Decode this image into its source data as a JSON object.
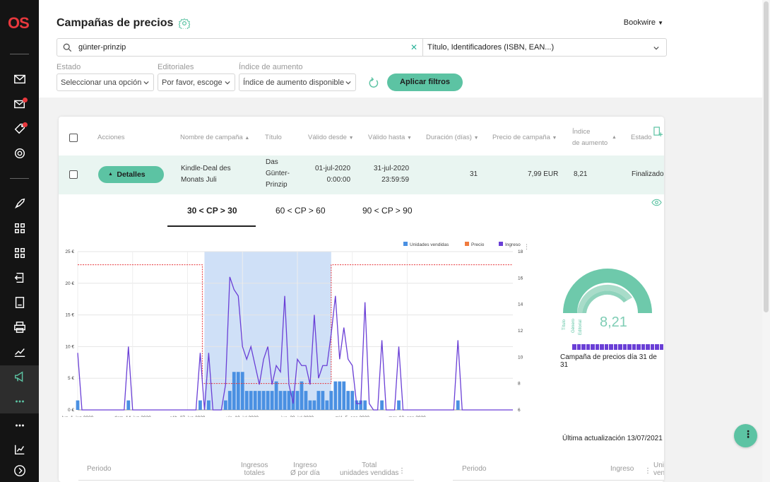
{
  "app": {
    "logo": "OS"
  },
  "header": {
    "title": "Campañas de precios",
    "account": "Bookwire",
    "search": {
      "value": "günter-prinzip",
      "field": "Título, Identificadores (ISBN, EAN...)"
    },
    "filters": {
      "estado": {
        "label": "Estado",
        "value": "Seleccionar una opción"
      },
      "editoriales": {
        "label": "Editoriales",
        "value": "Por favor, escoge"
      },
      "indice": {
        "label": "Índice de aumento",
        "value": "Índice de aumento disponible"
      },
      "apply_label": "Aplicar filtros"
    }
  },
  "table": {
    "headers": {
      "acciones": "Acciones",
      "nombre": "Nombre de campaña",
      "titulo": "Título",
      "desde": "Válido desde",
      "hasta": "Válido hasta",
      "duracion": "Duración (días)",
      "precio": "Precio de campaña",
      "indice_l1": "Índice",
      "indice_l2": "de aumento",
      "estado": "Estado"
    },
    "row": {
      "details_label": "Detalles",
      "nombre_l1": "Kindle-Deal des",
      "nombre_l2": "Monats Juli",
      "titulo_l1": "Das",
      "titulo_l2": "Günter-",
      "titulo_l3": "Prinzip",
      "desde_l1": "01-jul-2020",
      "desde_l2": "0:00:00",
      "hasta_l1": "31-jul-2020",
      "hasta_l2": "23:59:59",
      "duracion": "31",
      "precio": "7,99 EUR",
      "indice": "8,21",
      "estado": "Finalizado"
    }
  },
  "tabs": [
    "30 < CP > 30",
    "60 < CP > 60",
    "90 < CP > 90"
  ],
  "chart_data": {
    "type": "bar",
    "legend": [
      "Unidades vendidas",
      "Precio",
      "Ingreso"
    ],
    "y_left_ticks": [
      "0 €",
      "5 €",
      "10 €",
      "15 €",
      "20 €",
      "25 €"
    ],
    "y_right_ticks": [
      "6",
      "8",
      "10",
      "12",
      "14",
      "16",
      "18"
    ],
    "y_right_label": "Precio",
    "x_ticks": [
      "lun, 1. jun 2020",
      "dom, 14. jun 2020",
      "sáb, 27. jun 2020",
      "vie, 10. jul 2020",
      "jue, 23. jul 2020",
      "mié, 5. ago 2020",
      "mar, 18. ago 2020"
    ],
    "ylim_left": [
      0,
      25
    ],
    "ylim_right": [
      6,
      18
    ],
    "campaign_window_days": [
      30,
      60
    ],
    "units": [
      1,
      0,
      0,
      0,
      0,
      0,
      0,
      0,
      0,
      0,
      0,
      0,
      1,
      0,
      0,
      0,
      0,
      0,
      0,
      0,
      0,
      0,
      0,
      0,
      0,
      0,
      0,
      0,
      0,
      1,
      0,
      1,
      0,
      0,
      0,
      1,
      2,
      4,
      4,
      4,
      2,
      2,
      2,
      2,
      2,
      2,
      2,
      3,
      2,
      2,
      2,
      2,
      2,
      3,
      2,
      1,
      1,
      2,
      2,
      1,
      2,
      3,
      3,
      3,
      2,
      2,
      1,
      1,
      1,
      0,
      0,
      0,
      1,
      0,
      0,
      0,
      1,
      0,
      0,
      0,
      0,
      0,
      0,
      0,
      0,
      0,
      0,
      0,
      0,
      0,
      1,
      0,
      0,
      0,
      0,
      0,
      0,
      0,
      0,
      0,
      0,
      0,
      0,
      0
    ],
    "ingreso": [
      9,
      0,
      0,
      0,
      0,
      0,
      0,
      0,
      0,
      0,
      0,
      0,
      10,
      0,
      0,
      0,
      0,
      0,
      0,
      0,
      0,
      0,
      0,
      0,
      0,
      0,
      0,
      0,
      0,
      9,
      0,
      9,
      0,
      0,
      0,
      4,
      21,
      19,
      18,
      10,
      8,
      10,
      7,
      4,
      8,
      10,
      4,
      7,
      6,
      18,
      4,
      1,
      8,
      7,
      7,
      4,
      15,
      5,
      7,
      7,
      12,
      18,
      8,
      13,
      8,
      7,
      1,
      1,
      17,
      1,
      0,
      0,
      11,
      0,
      0,
      0,
      10,
      0,
      0,
      0,
      0,
      0,
      0,
      0,
      0,
      0,
      0,
      0,
      0,
      0,
      11,
      0,
      0,
      0,
      0,
      0,
      0,
      0,
      0,
      0,
      0,
      0,
      0,
      0
    ],
    "precio": {
      "base": 17,
      "campaign": 8
    }
  },
  "gauge": {
    "value": "8,21",
    "labels": [
      "Título",
      "Género",
      "Editorial"
    ],
    "progress_text": "Campaña de precios día 31 de 31",
    "progress": 1.0
  },
  "update_text": "Última actualización 13/07/2021",
  "bottom_headers": {
    "periodo1": "Periodo",
    "ingresos_l1": "Ingresos",
    "ingresos_l2": "totales",
    "ingreso_dia_l1": "Ingreso",
    "ingreso_dia_l2": "Ø por día",
    "total_l1": "Total",
    "total_l2": "unidades vendidas",
    "periodo2": "Periodo",
    "ingreso2": "Ingreso",
    "uni_l1": "Uni",
    "uni_l2": "ven"
  }
}
